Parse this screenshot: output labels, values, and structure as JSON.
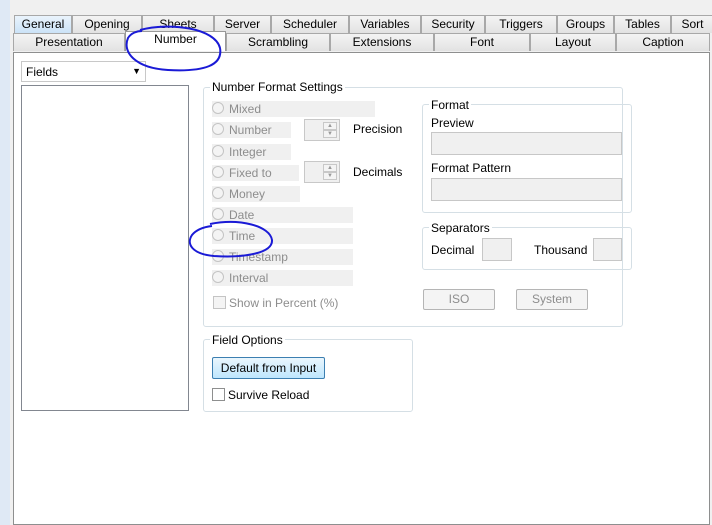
{
  "tabs_row1": [
    "General",
    "Opening",
    "Sheets",
    "Server",
    "Scheduler",
    "Variables",
    "Security",
    "Triggers",
    "Groups",
    "Tables",
    "Sort"
  ],
  "tabs_row2": [
    "Presentation",
    "Number",
    "Scrambling",
    "Extensions",
    "Font",
    "Layout",
    "Caption"
  ],
  "fields_dropdown": {
    "value": "Fields"
  },
  "number_format": {
    "title": "Number Format Settings",
    "options": [
      "Mixed",
      "Number",
      "Integer",
      "Fixed to",
      "Money",
      "Date",
      "Time",
      "Timestamp",
      "Interval"
    ],
    "precision_label": "Precision",
    "decimals_label": "Decimals",
    "show_percent_label": "Show in Percent (%)",
    "format": {
      "title": "Format",
      "preview_label": "Preview",
      "pattern_label": "Format Pattern"
    },
    "separators": {
      "title": "Separators",
      "decimal_label": "Decimal",
      "thousand_label": "Thousand"
    },
    "iso_label": "ISO",
    "system_label": "System"
  },
  "field_options": {
    "title": "Field Options",
    "default_button": "Default from Input",
    "survive_reload": "Survive Reload"
  },
  "colors": {
    "annotation": "#1a1ad6",
    "accent": "#3c7fb1"
  }
}
